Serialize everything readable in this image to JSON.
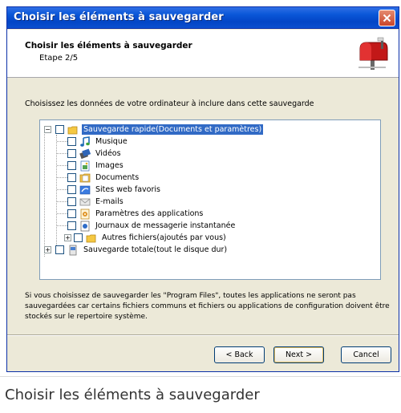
{
  "window": {
    "title": "Choisir les éléments à sauvegarder"
  },
  "header": {
    "title": "Choisir les éléments à sauvegarder",
    "step": "Etape 2/5",
    "logo_icon": "mailbox-icon"
  },
  "instruction": "Choisissez les données de votre ordinateur à inclure dans cette sauvegarde",
  "tree": {
    "items": [
      {
        "label": "Sauvegarde rapide(Documents et paramètres)",
        "icon": "folder-icon",
        "level": 0,
        "expander": "−",
        "selected": true
      },
      {
        "label": "Musique",
        "icon": "music-icon",
        "level": 1
      },
      {
        "label": "Vidéos",
        "icon": "video-icon",
        "level": 1
      },
      {
        "label": "Images",
        "icon": "image-icon",
        "level": 1
      },
      {
        "label": "Documents",
        "icon": "documents-icon",
        "level": 1
      },
      {
        "label": "Sites web favoris",
        "icon": "favorites-icon",
        "level": 1
      },
      {
        "label": "E-mails",
        "icon": "email-icon",
        "level": 1
      },
      {
        "label": "Paramètres des applications",
        "icon": "settings-icon",
        "level": 1
      },
      {
        "label": "Journaux de messagerie instantanée",
        "icon": "chat-log-icon",
        "level": 1
      },
      {
        "label": "Autres fichiers(ajoutés par vous)",
        "icon": "folder-icon",
        "level": 1,
        "expander": "+"
      },
      {
        "label": "Sauvegarde totale(tout le disque dur)",
        "icon": "disk-icon",
        "level": 0,
        "expander": "+"
      }
    ]
  },
  "note": "Si vous choisissez de sauvegarder les \"Program Files\", toutes les applications ne seront pas sauvegardées car certains fichiers communs et fichiers ou applications de configuration doivent être stockés sur le repertoire système.",
  "buttons": {
    "back": "< Back",
    "next": "Next >",
    "cancel": "Cancel"
  },
  "caption": "Choisir les éléments à sauvegarder"
}
